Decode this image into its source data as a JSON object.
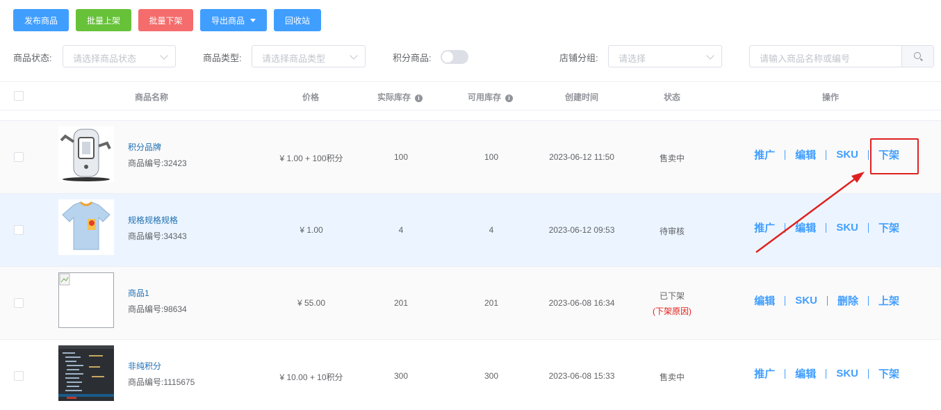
{
  "toolbar": {
    "publish": "发布商品",
    "batch_on": "批量上架",
    "batch_off": "批量下架",
    "export": "导出商品",
    "recycle": "回收站"
  },
  "filters": {
    "status_label": "商品状态:",
    "status_placeholder": "请选择商品状态",
    "type_label": "商品类型:",
    "type_placeholder": "请选择商品类型",
    "points_label": "积分商品:",
    "points_enabled": false,
    "group_label": "店铺分组:",
    "group_placeholder": "请选择",
    "search_placeholder": "请输入商品名称或编号"
  },
  "table": {
    "headers": {
      "name": "商品名称",
      "price": "价格",
      "actual_stock": "实际库存",
      "available_stock": "可用库存",
      "created": "创建时间",
      "status": "状态",
      "ops": "操作"
    },
    "rows": [
      {
        "name": "积分品牌",
        "code": "商品编号:32423",
        "price": "¥ 1.00 + 100积分",
        "actual_stock": "100",
        "available_stock": "100",
        "created": "2023-06-12 11:50",
        "status": "售卖中",
        "reason": "",
        "thumb": "robot",
        "ops": [
          "推广",
          "编辑",
          "SKU",
          "下架"
        ]
      },
      {
        "name": "规格规格规格",
        "code": "商品编号:34343",
        "price": "¥ 1.00",
        "actual_stock": "4",
        "available_stock": "4",
        "created": "2023-06-12 09:53",
        "status": "待审核",
        "reason": "",
        "thumb": "tshirt",
        "ops": [
          "推广",
          "编辑",
          "SKU",
          "下架"
        ]
      },
      {
        "name": "商品1",
        "code": "商品编号:98634",
        "price": "¥ 55.00",
        "actual_stock": "201",
        "available_stock": "201",
        "created": "2023-06-08 16:34",
        "status": "已下架",
        "reason": "(下架原因)",
        "thumb": "broken-image",
        "ops": [
          "编辑",
          "SKU",
          "删除",
          "上架"
        ]
      },
      {
        "name": "非纯积分",
        "code": "商品编号:1115675",
        "price": "¥ 10.00 + 10积分",
        "actual_stock": "300",
        "available_stock": "300",
        "created": "2023-06-08 15:33",
        "status": "售卖中",
        "reason": "",
        "thumb": "screenshot",
        "ops": [
          "推广",
          "编辑",
          "SKU",
          "下架"
        ]
      }
    ]
  },
  "colors": {
    "primary": "#409eff",
    "success": "#67c23a",
    "danger": "#f56c6c",
    "annotation": "#e02020"
  }
}
